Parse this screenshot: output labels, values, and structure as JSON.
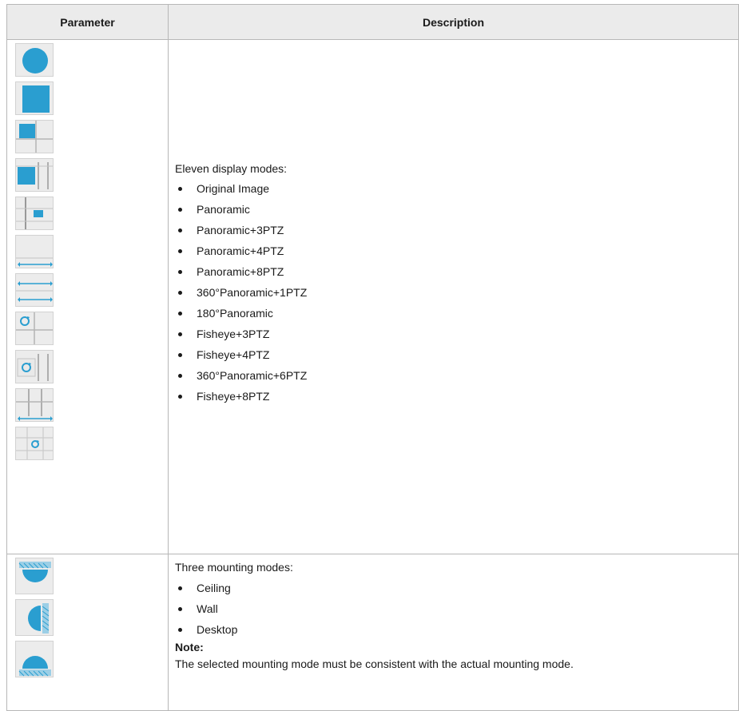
{
  "table": {
    "header": {
      "parameter": "Parameter",
      "description": "Description"
    },
    "display_modes": {
      "intro": "Eleven display modes:",
      "items": [
        "Original Image",
        "Panoramic",
        "Panoramic+3PTZ",
        "Panoramic+4PTZ",
        "Panoramic+8PTZ",
        "360°Panoramic+1PTZ",
        "180°Panoramic",
        "Fisheye+3PTZ",
        "Fisheye+4PTZ",
        "360°Panoramic+6PTZ",
        "Fisheye+8PTZ"
      ],
      "icons": [
        "original-image-icon",
        "panoramic-icon",
        "panoramic-3ptz-icon",
        "panoramic-4ptz-icon",
        "panoramic-8ptz-icon",
        "panoramic-360-1ptz-icon",
        "panoramic-180-icon",
        "fisheye-3ptz-icon",
        "fisheye-4ptz-icon",
        "panoramic-360-6ptz-icon",
        "fisheye-8ptz-icon"
      ]
    },
    "mounting_modes": {
      "intro": "Three mounting modes:",
      "items": [
        "Ceiling",
        "Wall",
        "Desktop"
      ],
      "icons": [
        "ceiling-mount-icon",
        "wall-mount-icon",
        "desktop-mount-icon"
      ],
      "note_title": "Note:",
      "note_text": "The selected mounting mode must be consistent with the actual mounting mode."
    },
    "colors": {
      "accent": "#2a9ed0",
      "icon_bg": "#ececec",
      "header_bg": "#ebebeb",
      "border": "#b7b7b7"
    }
  }
}
